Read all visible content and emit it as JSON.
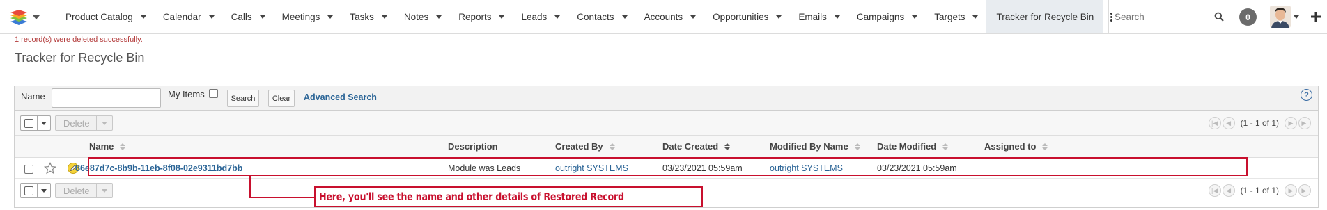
{
  "nav": {
    "items": [
      {
        "label": "Product Catalog"
      },
      {
        "label": "Calendar"
      },
      {
        "label": "Calls"
      },
      {
        "label": "Meetings"
      },
      {
        "label": "Tasks"
      },
      {
        "label": "Notes"
      },
      {
        "label": "Reports"
      },
      {
        "label": "Leads"
      },
      {
        "label": "Contacts"
      },
      {
        "label": "Accounts"
      },
      {
        "label": "Opportunities"
      },
      {
        "label": "Emails"
      },
      {
        "label": "Campaigns"
      },
      {
        "label": "Targets"
      }
    ],
    "active_item": "Tracker for Recycle Bin",
    "search_placeholder": "Search",
    "notification_count": "0"
  },
  "message": "1 record(s) were deleted successfully.",
  "page_title": "Tracker for Recycle Bin",
  "search_panel": {
    "name_label": "Name",
    "my_items_label": "My Items",
    "search_button": "Search",
    "clear_button": "Clear",
    "advanced_search_link": "Advanced Search",
    "help_icon": "?"
  },
  "list": {
    "delete_label": "Delete",
    "pagination_text": "(1 - 1 of 1)",
    "columns": [
      "Name",
      "Description",
      "Created By",
      "Date Created",
      "Modified By Name",
      "Date Modified",
      "Assigned to"
    ],
    "rows": [
      {
        "name": "86e87d7c-8b9b-11eb-8f08-02e9311bd7bb",
        "description": "Module was Leads",
        "created_by": "outright SYSTEMS",
        "date_created": "03/23/2021 05:59am",
        "modified_by": "outright SYSTEMS",
        "date_modified": "03/23/2021 05:59am",
        "assigned_to": ""
      }
    ]
  },
  "annotation": {
    "text": "Here, you'll see the name and other details of Restored Record",
    "color": "#c8102e"
  },
  "colors": {
    "link": "#2a6496",
    "message": "#b33b3b",
    "active_tab_bg": "#e8ecf0"
  }
}
